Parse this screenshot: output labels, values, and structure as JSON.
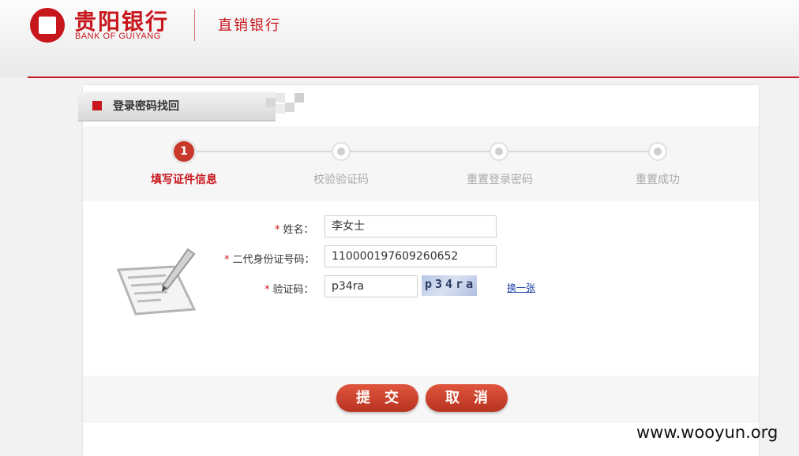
{
  "header": {
    "bank_name_cn": "贵阳银行",
    "bank_name_en": "BANK OF GUIYANG",
    "channel": "直销银行"
  },
  "panel": {
    "title": "登录密码找回"
  },
  "steps": {
    "current_number": "1",
    "items": [
      {
        "label": "填写证件信息",
        "active": true
      },
      {
        "label": "校验验证码",
        "active": false
      },
      {
        "label": "重置登录密码",
        "active": false
      },
      {
        "label": "重置成功",
        "active": false
      }
    ]
  },
  "form": {
    "required_mark": "*",
    "name_label": "姓名：",
    "name_value": "李女士",
    "id_label": "二代身份证号码：",
    "id_value": "110000197609260652",
    "captcha_label": "验证码：",
    "captcha_value": "p34ra",
    "captcha_image_text": "p34ra",
    "refresh_link": "换一张"
  },
  "actions": {
    "submit_label": "提交",
    "cancel_label": "取消"
  },
  "watermark": "www.wooyun.org",
  "colors": {
    "brand_red": "#c8161d",
    "button_red": "#c8392b",
    "link_blue": "#1a3ea8"
  }
}
